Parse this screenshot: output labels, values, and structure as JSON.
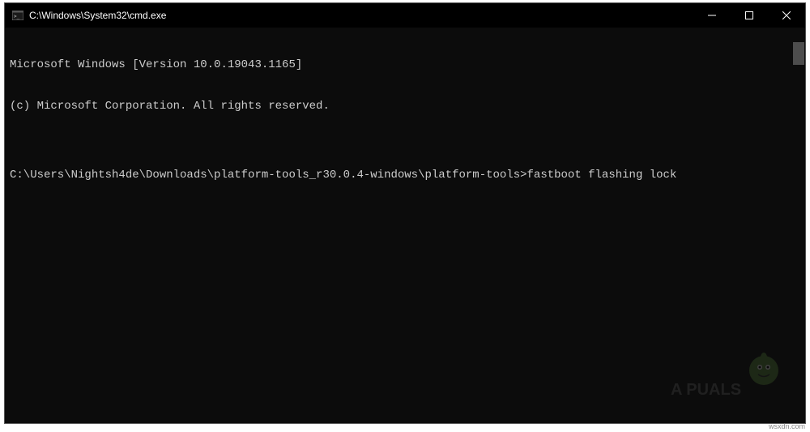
{
  "titlebar": {
    "path": "C:\\Windows\\System32\\cmd.exe"
  },
  "terminal": {
    "line1": "Microsoft Windows [Version 10.0.19043.1165]",
    "line2": "(c) Microsoft Corporation. All rights reserved.",
    "line3": "",
    "prompt": "C:\\Users\\Nightsh4de\\Downloads\\platform-tools_r30.0.4-windows\\platform-tools>",
    "command": "fastboot flashing lock"
  },
  "watermark": {
    "text": "A PUALS"
  },
  "source": "wsxdn.com"
}
